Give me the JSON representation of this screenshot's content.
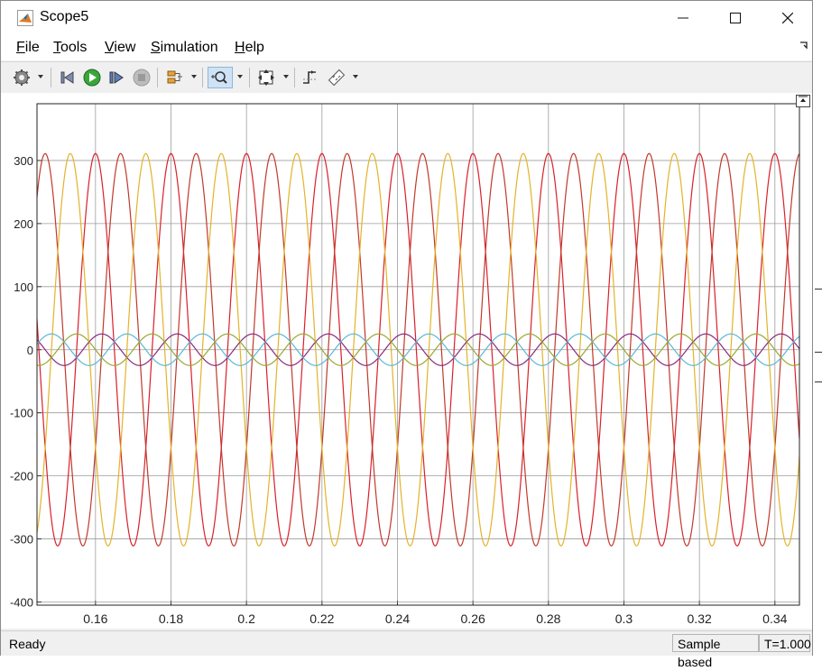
{
  "window": {
    "title": "Scope5"
  },
  "controls": {
    "minimize": "—",
    "maximize": "☐",
    "close": "✕"
  },
  "menu": [
    {
      "label": "File",
      "mnemonic": "F",
      "rest": "ile"
    },
    {
      "label": "Tools",
      "mnemonic": "T",
      "rest": "ools"
    },
    {
      "label": "View",
      "mnemonic": "V",
      "rest": "iew"
    },
    {
      "label": "Simulation",
      "mnemonic": "S",
      "rest": "imulation"
    },
    {
      "label": "Help",
      "mnemonic": "H",
      "rest": "elp"
    }
  ],
  "toolbar": {
    "icons": [
      "gear-icon",
      "step-back-icon",
      "run-icon",
      "step-forward-icon",
      "stop-icon",
      "signal-select-icon",
      "zoom-icon",
      "fit-view-icon",
      "triggers-icon",
      "measurements-icon"
    ]
  },
  "status": {
    "ready": "Ready",
    "mode": "Sample based",
    "time": "T=1.000"
  },
  "chart_data": {
    "type": "line",
    "title": "",
    "xlabel": "",
    "ylabel": "",
    "xlim": [
      0.1445,
      0.3465
    ],
    "ylim": [
      -405,
      390
    ],
    "grid": true,
    "xticks": [
      0.16,
      0.18,
      0.2,
      0.22,
      0.24,
      0.26,
      0.28,
      0.3,
      0.32,
      0.34
    ],
    "xtick_labels": [
      "0.16",
      "0.18",
      "0.2",
      "0.22",
      "0.24",
      "0.26",
      "0.28",
      "0.3",
      "0.32",
      "0.34"
    ],
    "yticks": [
      300,
      200,
      100,
      0,
      -100,
      -200,
      -300,
      -400
    ],
    "ytick_labels": [
      "300",
      "200",
      "100",
      "0",
      "-100",
      "-200",
      "-300",
      "-400"
    ],
    "frequency_hz": 50,
    "series": [
      {
        "kind": "voltage phase A",
        "amplitude": 311,
        "phase_deg": 90,
        "color": "#d9202b"
      },
      {
        "kind": "voltage phase B",
        "amplitude": 311,
        "phase_deg": -30,
        "color": "#c0392b"
      },
      {
        "kind": "voltage phase C",
        "amplitude": 311,
        "phase_deg": 210,
        "color": "#e3b32a"
      },
      {
        "kind": "current phase A",
        "amplitude": 25,
        "phase_deg": 60,
        "color": "#8b2a7b"
      },
      {
        "kind": "current phase B",
        "amplitude": 25,
        "phase_deg": -60,
        "color": "#5ab8d6"
      },
      {
        "kind": "current phase C",
        "amplitude": 25,
        "phase_deg": 180,
        "color": "#9aa832"
      }
    ]
  }
}
